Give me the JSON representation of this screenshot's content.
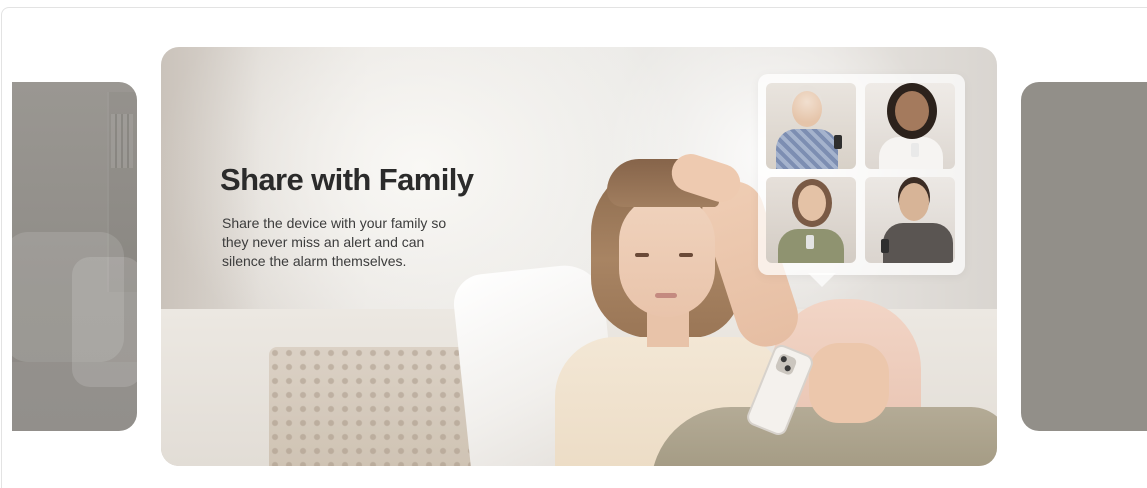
{
  "carousel": {
    "active_slide": {
      "title": "Share with Family",
      "description": "Share the device with your family so\nthey never miss an alert and can\nsilence the alarm themselves."
    }
  },
  "colors": {
    "title": "#2b2b2b",
    "description": "#3c3c3c",
    "side_slide": "#928f89"
  },
  "icons": {
    "family_grid": "family-video-grid"
  }
}
